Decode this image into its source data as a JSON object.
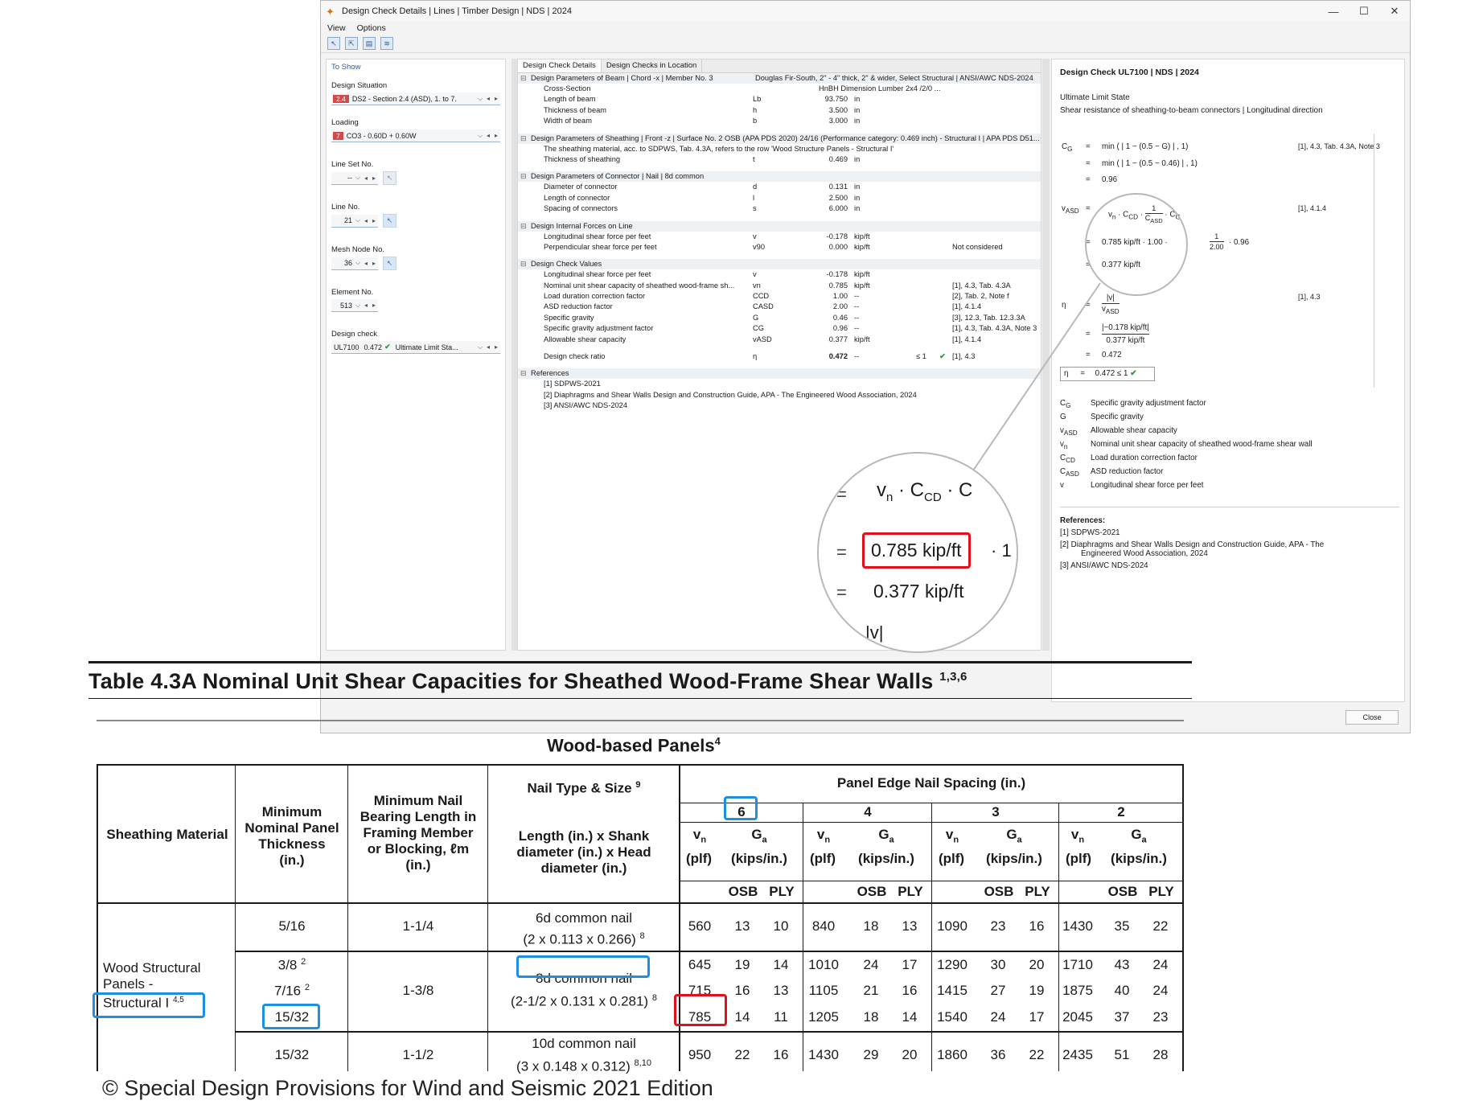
{
  "window": {
    "title": "Design Check Details | Lines | Timber Design | NDS | 2024",
    "menu": [
      "View",
      "Options"
    ],
    "close_button": "Close"
  },
  "left_panel": {
    "header": "To Show",
    "design_situation_label": "Design Situation",
    "design_situation_tag": "2.4",
    "design_situation_value": "DS2 - Section 2.4 (ASD), 1. to 7.",
    "loading_label": "Loading",
    "loading_tag": "7",
    "loading_value": "CO3 - 0.60D + 0.60W",
    "line_set_label": "Line Set No.",
    "line_set_value": "--",
    "line_no_label": "Line No.",
    "line_no_value": "21",
    "mesh_node_label": "Mesh Node No.",
    "mesh_node_value": "36",
    "element_label": "Element No.",
    "element_value": "513",
    "design_check_label": "Design check",
    "design_check_id": "UL7100",
    "design_check_ratio": "0.472",
    "design_check_type": "Ultimate Limit Sta..."
  },
  "mid_panel": {
    "tabs": [
      "Design Check Details",
      "Design Checks in Location"
    ],
    "sec_beam": {
      "header": "Design Parameters of Beam | Chord -x | Member No. 3",
      "header_right": "Douglas Fir-South, 2\" - 4\" thick, 2\" & wider, Select Structural | ANSI/AWC NDS-2024",
      "rows": [
        {
          "d": "Cross-Section",
          "s": "",
          "v": "HnBH Dimension Lumber 2x4 /2/0 ...",
          "u": ""
        },
        {
          "d": "Length of beam",
          "s": "Lb",
          "v": "93.750",
          "u": "in"
        },
        {
          "d": "Thickness of beam",
          "s": "h",
          "v": "3.500",
          "u": "in"
        },
        {
          "d": "Width of beam",
          "s": "b",
          "v": "3.000",
          "u": "in"
        }
      ]
    },
    "sec_sheathing": {
      "header": "Design Parameters of Sheathing | Front -z | Surface No. 2 OSB (APA PDS 2020) 24/16 (Performance category: 0.469 inch) - Structural I | APA PDS D51...",
      "note": "The sheathing material, acc. to SDPWS, Tab. 4.3A, refers to the row 'Wood Structure Panels - Structural I'",
      "rows": [
        {
          "d": "Thickness of sheathing",
          "s": "t",
          "v": "0.469",
          "u": "in"
        }
      ]
    },
    "sec_connector": {
      "header": "Design Parameters of Connector | Nail | 8d common",
      "rows": [
        {
          "d": "Diameter of connector",
          "s": "d",
          "v": "0.131",
          "u": "in"
        },
        {
          "d": "Length of connector",
          "s": "l",
          "v": "2.500",
          "u": "in"
        },
        {
          "d": "Spacing of connectors",
          "s": "s",
          "v": "6.000",
          "u": "in"
        }
      ]
    },
    "sec_forces": {
      "header": "Design Internal Forces on Line",
      "rows": [
        {
          "d": "Longitudinal shear force per feet",
          "s": "v",
          "v": "-0.178",
          "u": "kip/ft",
          "r": ""
        },
        {
          "d": "Perpendicular shear force per feet",
          "s": "v90",
          "v": "0.000",
          "u": "kip/ft",
          "r": "Not considered"
        }
      ]
    },
    "sec_check": {
      "header": "Design Check Values",
      "rows": [
        {
          "d": "Longitudinal shear force per feet",
          "s": "v",
          "v": "-0.178",
          "u": "kip/ft",
          "r": ""
        },
        {
          "d": "Nominal unit shear capacity of sheathed wood-frame sh...",
          "s": "vn",
          "v": "0.785",
          "u": "kip/ft",
          "r": "[1], 4.3, Tab. 4.3A"
        },
        {
          "d": "Load duration correction factor",
          "s": "CCD",
          "v": "1.00",
          "u": "--",
          "r": "[2], Tab. 2, Note f"
        },
        {
          "d": "ASD reduction factor",
          "s": "CASD",
          "v": "2.00",
          "u": "--",
          "r": "[1], 4.1.4"
        },
        {
          "d": "Specific gravity",
          "s": "G",
          "v": "0.46",
          "u": "--",
          "r": "[3], 12.3, Tab. 12.3.3A"
        },
        {
          "d": "Specific gravity adjustment factor",
          "s": "CG",
          "v": "0.96",
          "u": "--",
          "r": "[1], 4.3, Tab. 4.3A, Note 3"
        },
        {
          "d": "Allowable shear capacity",
          "s": "vASD",
          "v": "0.377",
          "u": "kip/ft",
          "r": "[1], 4.1.4"
        }
      ],
      "ratio": {
        "d": "Design check ratio",
        "s": "η",
        "v": "0.472",
        "u": "--",
        "rel": "≤ 1",
        "r": "[1], 4.3"
      }
    },
    "sec_refs": {
      "header": "References",
      "rows": [
        "[1]  SDPWS-2021",
        "[2]  Diaphragms and Shear Walls Design and Construction Guide, APA - The Engineered Wood Association, 2024",
        "[3]  ANSI/AWC NDS-2024"
      ]
    }
  },
  "right_panel": {
    "title": "Design Check UL7100 | NDS | 2024",
    "limit_state": "Ultimate Limit State",
    "description": "Shear resistance of sheathing-to-beam connectors | Longitudinal direction",
    "cg_lines": [
      "min ( | 1  −  (0.5  −  G) | ,  1)",
      "min ( | 1  −  (0.5  −  0.46) | ,  1)",
      "0.96"
    ],
    "cg_ref": "[1], 4.3, Tab. 4.3A, Note 3",
    "vasd_ref": "[1], 4.1.4",
    "vasd_line2": "0.785 kip/ft  ·  1.00  ·",
    "vasd_result": "0.377 kip/ft",
    "eta_ref": "[1], 4.3",
    "eta_num": "|−0.178 kip/ft|",
    "eta_den": "0.377 kip/ft",
    "eta_val": "0.472",
    "eta_box": "0.472  ≤ 1",
    "legend": [
      {
        "s": "CG",
        "d": "Specific gravity adjustment factor"
      },
      {
        "s": "G",
        "d": "Specific gravity"
      },
      {
        "s": "vASD",
        "d": "Allowable shear capacity"
      },
      {
        "s": "vn",
        "d": "Nominal unit shear capacity of sheathed wood-frame shear wall"
      },
      {
        "s": "CCD",
        "d": "Load duration correction factor"
      },
      {
        "s": "CASD",
        "d": "ASD reduction factor"
      },
      {
        "s": "v",
        "d": "Longitudinal shear force per feet"
      }
    ],
    "refs_title": "References:",
    "refs": [
      "[1]   SDPWS-2021",
      "[2]   Diaphragms and Shear Walls Design and Construction Guide, APA - The",
      "Engineered Wood Association, 2024",
      "[3]   ANSI/AWC NDS-2024"
    ]
  },
  "magnifier": {
    "line1": "vn · CCD ·",
    "line2": "0.785 kip/ft",
    "line2_suffix": "· 1",
    "line3": "0.377 kip/ft",
    "line4": "|v|"
  },
  "table": {
    "title": "Table 4.3A Nominal Unit Shear Capacities for Sheathed Wood-Frame Shear Walls",
    "title_sup": "1,3,6",
    "subtitle": "Wood-based Panels",
    "subtitle_sup": "4",
    "headers": {
      "sheathing": "Sheathing Material",
      "thickness": [
        "Minimum",
        "Nominal Panel",
        "Thickness",
        "(in.)"
      ],
      "bearing": [
        "Minimum Nail",
        "Bearing Length in",
        "Framing Member",
        "or Blocking, ℓm",
        "(in.)"
      ],
      "nail_type": "Nail Type & Size",
      "nail_sup": "9",
      "nail_desc": [
        "Length (in.) x Shank",
        "diameter (in.) x Head",
        "diameter (in.)"
      ],
      "spacing": "Panel Edge Nail Spacing (in.)",
      "spacings": [
        "6",
        "4",
        "3",
        "2"
      ],
      "vn": "vn",
      "ga": "Ga",
      "plf": "(plf)",
      "kips": "(kips/in.)",
      "osb": "OSB",
      "ply": "PLY"
    },
    "material": [
      "Wood Structural",
      "Panels -",
      "Structural I"
    ],
    "material_sup": "4,5",
    "groups": [
      {
        "thick": [
          "5/16"
        ],
        "bearing": "1-1/4",
        "nail": "6d common nail",
        "nail2": "(2 x 0.113 x 0.266)",
        "sup": "8",
        "rows": [
          [
            "560",
            "13",
            "10",
            "840",
            "18",
            "13",
            "1090",
            "23",
            "16",
            "1430",
            "35",
            "22"
          ]
        ]
      },
      {
        "thick": [
          "3/8",
          "7/16",
          "15/32"
        ],
        "thick_sups": [
          "2",
          "2",
          ""
        ],
        "bearing": "1-3/8",
        "nail": "8d common nail",
        "nail2": "(2-1/2 x 0.131 x 0.281)",
        "sup": "8",
        "rows": [
          [
            "645",
            "19",
            "14",
            "1010",
            "24",
            "17",
            "1290",
            "30",
            "20",
            "1710",
            "43",
            "24"
          ],
          [
            "715",
            "16",
            "13",
            "1105",
            "21",
            "16",
            "1415",
            "27",
            "19",
            "1875",
            "40",
            "24"
          ],
          [
            "785",
            "14",
            "11",
            "1205",
            "18",
            "14",
            "1540",
            "24",
            "17",
            "2045",
            "37",
            "23"
          ]
        ]
      },
      {
        "thick": [
          "15/32"
        ],
        "bearing": "1-1/2",
        "nail": "10d common nail",
        "nail2": "(3 x 0.148 x 0.312)",
        "sup": "8,10",
        "rows": [
          [
            "950",
            "22",
            "16",
            "1430",
            "29",
            "20",
            "1860",
            "36",
            "22",
            "2435",
            "51",
            "28"
          ]
        ]
      }
    ]
  },
  "copyright": "© Special Design Provisions for Wind and Seismic 2021 Edition",
  "colors": {
    "highlight_blue": "#1e8ee0",
    "highlight_red": "#e0101c",
    "accent_tag": "#d04a4a"
  }
}
